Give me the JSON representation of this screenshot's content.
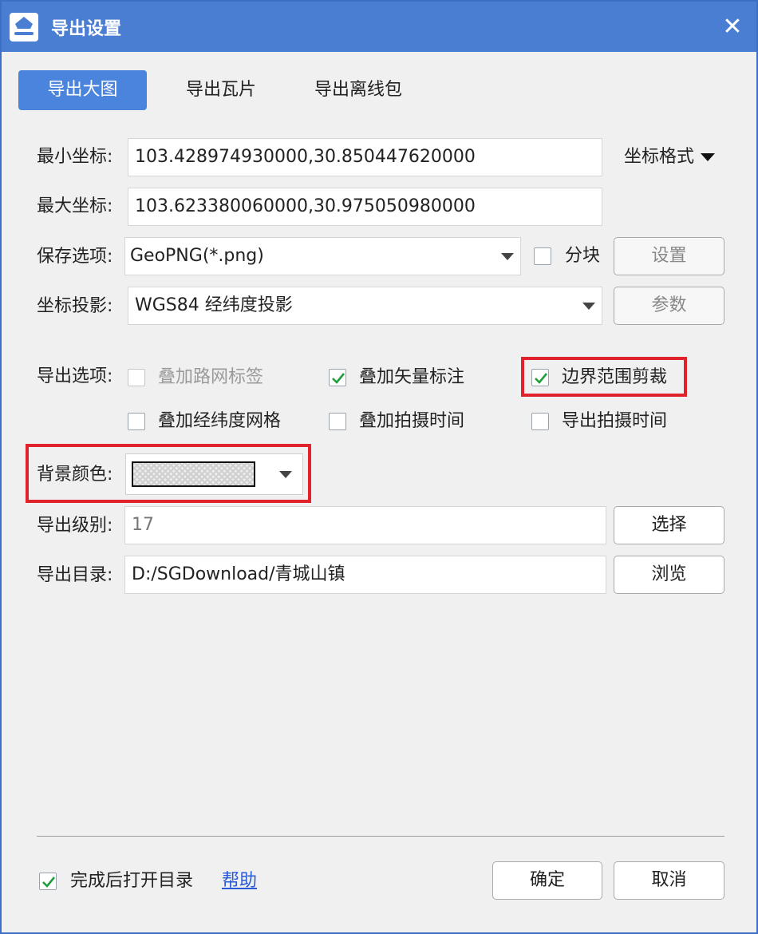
{
  "window": {
    "title": "导出设置",
    "close": "✕"
  },
  "tabs": [
    {
      "label": "导出大图",
      "active": true
    },
    {
      "label": "导出瓦片",
      "active": false
    },
    {
      "label": "导出离线包",
      "active": false
    }
  ],
  "form": {
    "min_coord": {
      "label": "最小坐标:",
      "value": "103.428974930000,30.850447620000"
    },
    "max_coord": {
      "label": "最大坐标:",
      "value": "103.623380060000,30.975050980000"
    },
    "coord_format": {
      "label": "坐标格式"
    },
    "save_option": {
      "label": "保存选项:",
      "value": "GeoPNG(*.png)"
    },
    "tile_split": {
      "label": "分块",
      "checked": false
    },
    "settings_button": "设置",
    "projection": {
      "label": "坐标投影:",
      "value": "WGS84 经纬度投影"
    },
    "params_button": "参数",
    "export_options": {
      "label": "导出选项:",
      "items": [
        {
          "label": "叠加路网标签",
          "checked": false,
          "disabled": true
        },
        {
          "label": "叠加矢量标注",
          "checked": true,
          "disabled": false
        },
        {
          "label": "边界范围剪裁",
          "checked": true,
          "disabled": false
        },
        {
          "label": "叠加经纬度网格",
          "checked": false,
          "disabled": false
        },
        {
          "label": "叠加拍摄时间",
          "checked": false,
          "disabled": false
        },
        {
          "label": "导出拍摄时间",
          "checked": false,
          "disabled": false
        }
      ]
    },
    "bg_color": {
      "label": "背景颜色:"
    },
    "export_level": {
      "label": "导出级别:",
      "value": "17"
    },
    "choose_button": "选择",
    "export_dir": {
      "label": "导出目录:",
      "value": "D:/SGDownload/青城山镇"
    },
    "browse_button": "浏览"
  },
  "footer": {
    "open_dir_after": {
      "label": "完成后打开目录",
      "checked": true
    },
    "help_link": "帮助",
    "ok_button": "确定",
    "cancel_button": "取消"
  },
  "colors": {
    "titlebar": "#4a7ed2",
    "tab_active": "#4a84dd",
    "highlight": "#e0222b",
    "check_green": "#1e9e3a",
    "link": "#2a5bd6"
  }
}
